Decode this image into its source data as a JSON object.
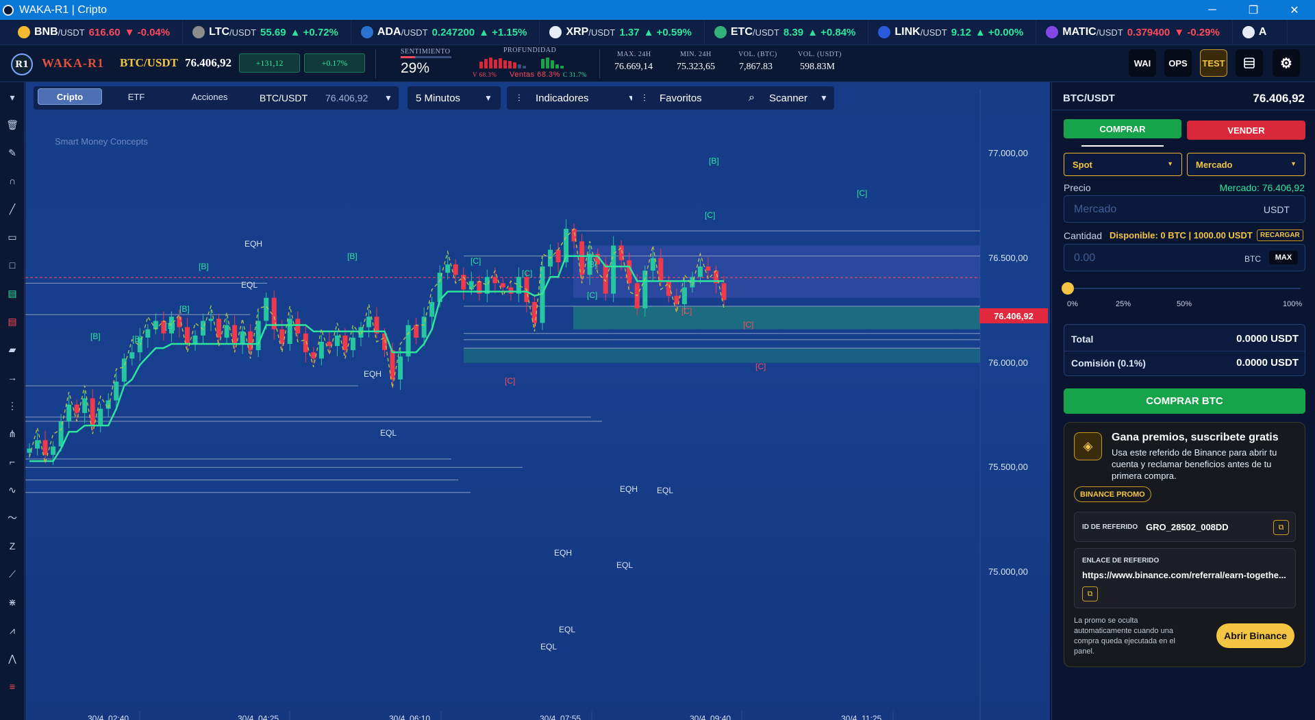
{
  "window": {
    "title": "WAKA-R1 | Cripto",
    "minimize": "─",
    "restore": "❐",
    "close": "✕"
  },
  "ticker": [
    {
      "symbol": "BNB",
      "quote": "/USDT",
      "price": "616.60",
      "change": "▼ -0.04%",
      "dir": "down",
      "coin_color": "#f3ba2f",
      "icon": "bnb-icon"
    },
    {
      "symbol": "LTC",
      "quote": "/USDT",
      "price": "55.69",
      "change": "▲ +0.72%",
      "dir": "up",
      "coin_color": "#8c8c8c",
      "icon": "ltc-icon"
    },
    {
      "symbol": "ADA",
      "quote": "/USDT",
      "price": "0.247200",
      "change": "▲ +1.15%",
      "dir": "up",
      "coin_color": "#2a71d0",
      "icon": "ada-icon"
    },
    {
      "symbol": "XRP",
      "quote": "/USDT",
      "price": "1.37",
      "change": "▲ +0.59%",
      "dir": "up",
      "coin_color": "#e6ecf7",
      "icon": "xrp-icon"
    },
    {
      "symbol": "ETC",
      "quote": "/USDT",
      "price": "8.39",
      "change": "▲ +0.84%",
      "dir": "up",
      "coin_color": "#33b27a",
      "icon": "etc-icon"
    },
    {
      "symbol": "LINK",
      "quote": "/USDT",
      "price": "9.12",
      "change": "▲ +0.00%",
      "dir": "up",
      "coin_color": "#2a5ada",
      "icon": "link-icon"
    },
    {
      "symbol": "MATIC",
      "quote": "/USDT",
      "price": "0.379400",
      "change": "▼ -0.29%",
      "dir": "down",
      "coin_color": "#8247e5",
      "icon": "matic-icon"
    },
    {
      "symbol": "A",
      "quote": "",
      "price": "",
      "change": "",
      "dir": "up",
      "coin_color": "#e6ecf7",
      "icon": "coin-icon"
    }
  ],
  "header": {
    "logo": "R1",
    "brand": "WAKA-R1",
    "pair": "BTC/USDT",
    "price": "76.406,92",
    "change_abs": "+131,12",
    "change_pct": "+0.17%",
    "sentiment_label": "SENTIMIENTO",
    "sentiment_value": "29%",
    "sentiment_fraction": 0.29,
    "depth_label": "PROFUNDIDAD",
    "depth_v": "V 68.3%",
    "depth_ventas": "Ventas 68.3%",
    "depth_c": "C 31.7%",
    "max_label": "MAX. 24H",
    "max_value": "76.669,14",
    "min_label": "MIN. 24H",
    "min_value": "75.323,65",
    "volbtc_label": "VOL. (BTC)",
    "volbtc_value": "7,867.83",
    "volusdt_label": "VOL. (USDT)",
    "volusdt_value": "598.83M",
    "buttons": [
      "WAI",
      "OPS",
      "TEST"
    ]
  },
  "toolbar": {
    "segments": [
      "Cripto",
      "ETF",
      "Acciones"
    ],
    "symbol": "BTC/USDT",
    "symbol_price": "76.406,92",
    "interval": "5 Minutos",
    "indicators": "Indicadores",
    "favorites": "Favoritos",
    "scanner": "Scanner"
  },
  "chart_data": {
    "type": "candlestick",
    "title": "Smart Money Concepts",
    "price_axis_ticks": [
      "77.000,00",
      "76.500,00",
      "76.000,00",
      "75.500,00",
      "75.000,00"
    ],
    "time_axis_ticks": [
      "30/4, 02:40",
      "30/4, 04:25",
      "30/4, 06:10",
      "30/4, 07:55",
      "30/4, 09:40",
      "30/4, 11:25"
    ],
    "last_price": "76.406,92",
    "ylim": [
      75000,
      77000
    ],
    "markers": [
      {
        "text": "EQH",
        "kind": "eqh"
      },
      {
        "text": "EQL",
        "kind": "eql"
      },
      {
        "text": "[B]",
        "kind": "bos"
      },
      {
        "text": "[C]",
        "kind": "choch"
      }
    ],
    "close_series": [
      75590,
      75630,
      75560,
      75600,
      75720,
      75800,
      75760,
      75830,
      75700,
      75780,
      75820,
      75910,
      76020,
      76050,
      76120,
      76160,
      76200,
      76140,
      76220,
      76170,
      76090,
      76130,
      76200,
      76210,
      76120,
      76180,
      76090,
      76150,
      76060,
      76200,
      76310,
      76160,
      76090,
      76210,
      76140,
      76050,
      76020,
      76100,
      76080,
      76130,
      76060,
      76120,
      76170,
      76220,
      76140,
      76060,
      75920,
      76030,
      76180,
      76120,
      76220,
      76290,
      76430,
      76470,
      76420,
      76350,
      76390,
      76330,
      76410,
      76380,
      76360,
      76330,
      76410,
      76290,
      76190,
      76460,
      76540,
      76480,
      76640,
      76580,
      76420,
      76520,
      76470,
      76330,
      76560,
      76490,
      76380,
      76260,
      76440,
      76500,
      76390,
      76320,
      76280,
      76360,
      76410,
      76460,
      76440,
      76380,
      76300
    ]
  },
  "panel": {
    "pair": "BTC/USDT",
    "price": "76.406,92",
    "buy": "COMPRAR",
    "sell": "VENDER",
    "type": "Spot",
    "order": "Mercado",
    "price_label": "Precio",
    "market_price": "Mercado: 76.406,92",
    "price_placeholder": "Mercado",
    "price_unit": "USDT",
    "qty_label": "Cantidad",
    "available": "Disponible: 0 BTC | 1000.00 USDT",
    "recharge": "RECARGAR",
    "qty_placeholder": "0.00",
    "qty_unit": "BTC",
    "max": "MAX",
    "slider_fraction": 0,
    "slider_ticks": [
      "0%",
      "25%",
      "50%",
      "100%"
    ],
    "total_label": "Total",
    "total_value": "0.0000 USDT",
    "fee_label": "Comisión (0.1%)",
    "fee_value": "0.0000 USDT",
    "submit": "COMPRAR BTC",
    "promo": {
      "title": "Gana premios, suscribete gratis",
      "text": "Usa este referido de Binance para abrir tu cuenta y reclamar beneficios antes de tu primera compra.",
      "badge": "BINANCE PROMO",
      "ref_id_label": "ID DE REFERIDO",
      "ref_id": "GRO_28502_008DD",
      "link_label": "ENLACE DE REFERIDO",
      "link": "https://www.binance.com/referral/earn-togethe...",
      "note": "La promo se oculta automaticamente cuando una compra queda ejecutada en el panel.",
      "cta": "Abrir Binance"
    }
  }
}
